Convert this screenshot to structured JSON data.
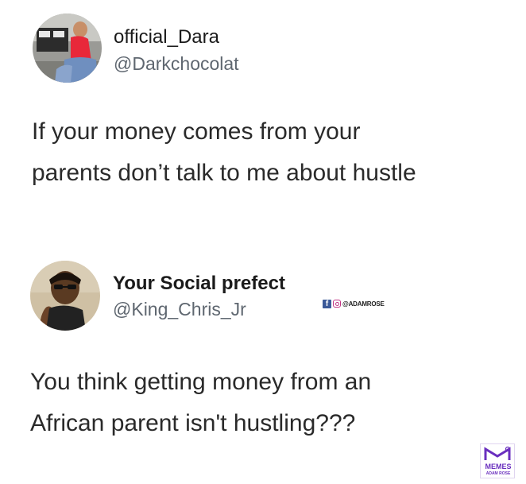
{
  "tweets": [
    {
      "display_name": "official_Dara",
      "handle": "@Darkchocolat",
      "text_lines": [
        "If your money comes from your",
        "parents don’t talk to me about hustle"
      ]
    },
    {
      "display_name": "Your Social prefect",
      "handle": "@King_Chris_Jr",
      "text_lines": [
        "You think getting money from an",
        "African parent isn't hustling???"
      ]
    }
  ],
  "watermark": {
    "tag": "@ADAMROSE",
    "logo_word": "MEMES",
    "logo_sub": "ADAM ROSE",
    "brand_color": "#6a2fbf"
  }
}
